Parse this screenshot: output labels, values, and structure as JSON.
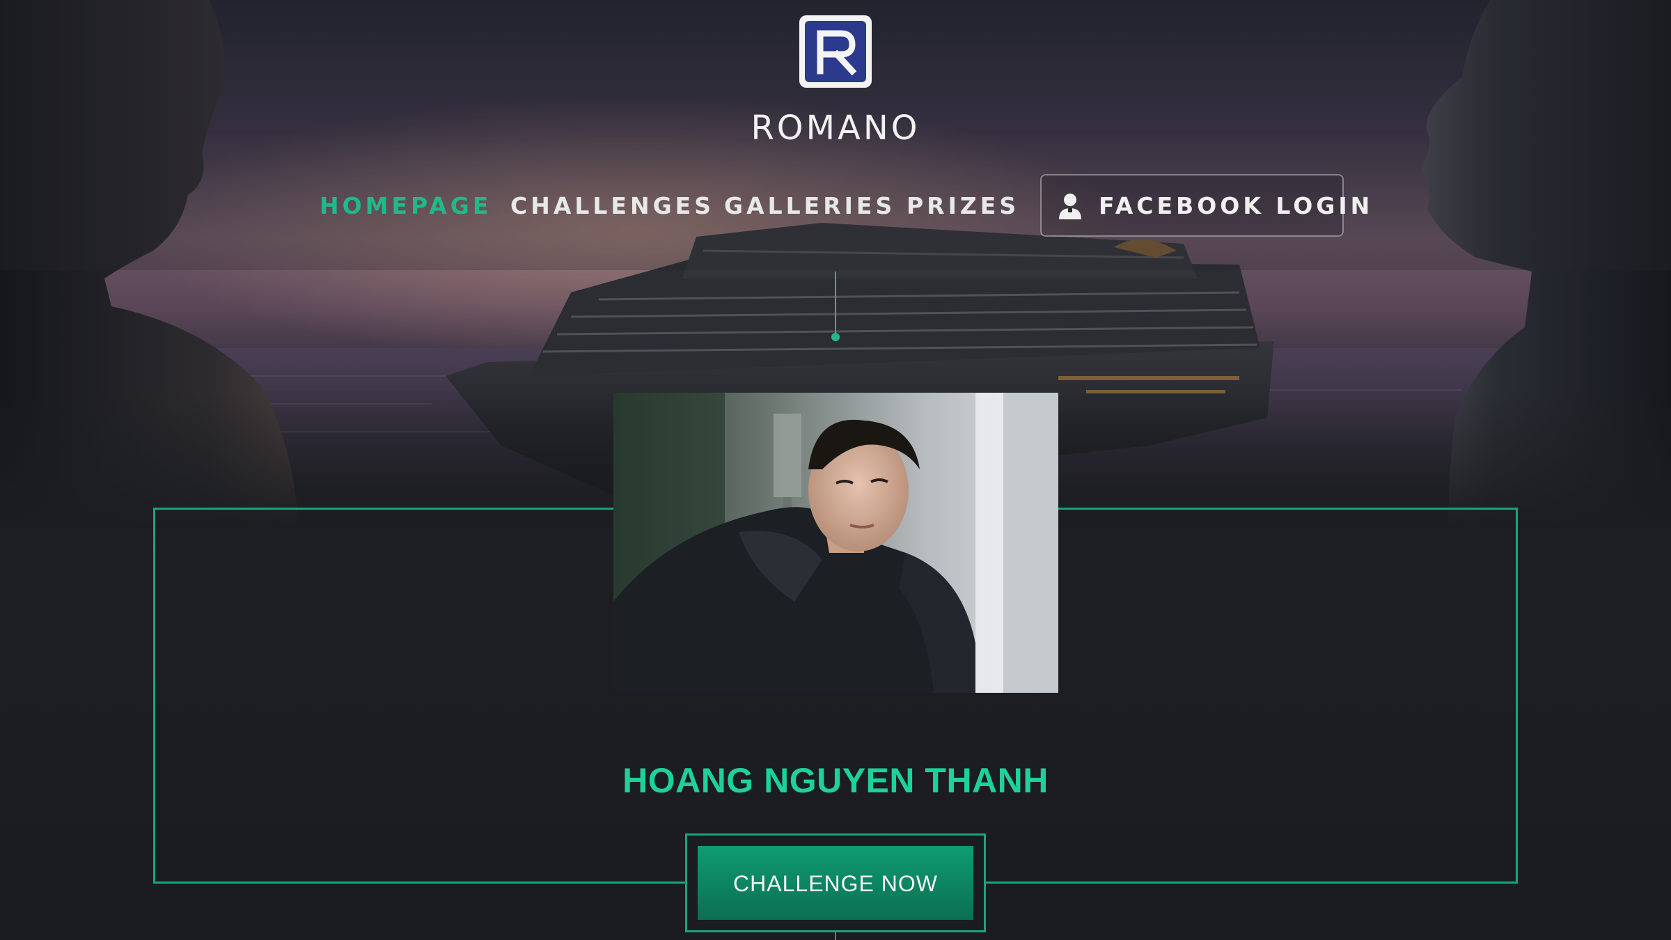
{
  "brand": {
    "logo_letter": "R",
    "name": "ROMANO"
  },
  "nav": {
    "items": [
      {
        "label": "HOMEPAGE",
        "active": true
      },
      {
        "label": "CHALLENGES",
        "active": false
      },
      {
        "label": "GALLERIES",
        "active": false
      },
      {
        "label": "PRIZES",
        "active": false
      }
    ],
    "login_label": "FACEBOOK LOGIN",
    "login_icon": "user-icon"
  },
  "profile": {
    "name": "HOANG NGUYEN THANH",
    "cta_label": "CHALLENGE NOW"
  },
  "colors": {
    "accent": "#1fb98a",
    "name_color": "#1ed19a",
    "logo_blue": "#2b3a8c",
    "background": "#1b1d20"
  }
}
